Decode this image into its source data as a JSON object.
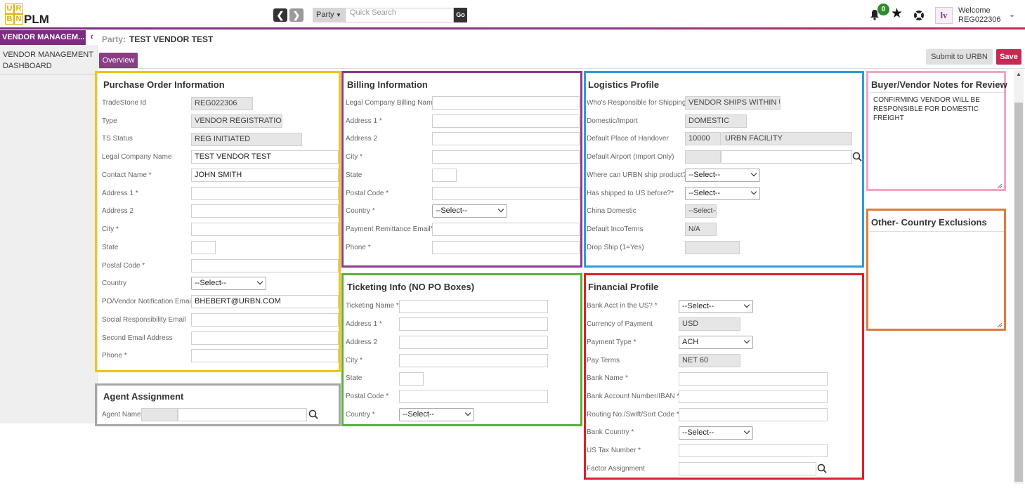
{
  "brand": {
    "logo_letters": [
      "U",
      "R",
      "B",
      "N"
    ],
    "app_name": "PLM"
  },
  "header": {
    "party_dropdown": "Party",
    "search_placeholder": "Quick Search",
    "go_label": "Go",
    "notification_count": "0",
    "welcome_label": "Welcome",
    "user_id": "REG022306",
    "avatar_initials": "lv"
  },
  "sidebar": {
    "header_label": "VENDOR MANAGEM...",
    "items": [
      {
        "label": "VENDOR MANAGEMENT DASHBOARD"
      }
    ]
  },
  "page": {
    "party_label": "Party:",
    "party_name": "TEST VENDOR TEST",
    "tab_overview": "Overview",
    "submit_label": "Submit to URBN",
    "save_label": "Save"
  },
  "po_info": {
    "title": "Purchase Order Information",
    "fields": [
      {
        "label": "TradeStone Id",
        "value": "REG022306"
      },
      {
        "label": "Type",
        "value": "VENDOR REGISTRATION"
      },
      {
        "label": "TS Status",
        "value": "REG INITIATED"
      },
      {
        "label": "Legal Company Name",
        "value": "TEST VENDOR TEST"
      },
      {
        "label": "Contact Name *",
        "value": "JOHN SMITH"
      },
      {
        "label": "Address 1 *",
        "value": ""
      },
      {
        "label": "Address 2",
        "value": ""
      },
      {
        "label": "City *",
        "value": ""
      },
      {
        "label": "State",
        "value": ""
      },
      {
        "label": "Postal Code *",
        "value": ""
      },
      {
        "label": "Country",
        "value": "--Select--"
      },
      {
        "label": "PO/Vendor Notification Email",
        "value": "BHEBERT@URBN.COM"
      },
      {
        "label": "Social Responsibility Email",
        "value": ""
      },
      {
        "label": "Second Email Address",
        "value": ""
      },
      {
        "label": "Phone *",
        "value": ""
      }
    ]
  },
  "agent": {
    "title": "Agent Assignment",
    "label": "Agent Name",
    "value": ""
  },
  "billing": {
    "title": "Billing Information",
    "fields": [
      {
        "label": "Legal Company Billing Name",
        "value": ""
      },
      {
        "label": "Address 1 *",
        "value": ""
      },
      {
        "label": "Address 2",
        "value": ""
      },
      {
        "label": "City *",
        "value": ""
      },
      {
        "label": "State",
        "value": ""
      },
      {
        "label": "Postal Code *",
        "value": ""
      },
      {
        "label": "Country *",
        "value": "--Select--"
      },
      {
        "label": "Payment Remittance Email*",
        "value": ""
      },
      {
        "label": "Phone *",
        "value": ""
      }
    ]
  },
  "ticketing": {
    "title": "Ticketing Info (NO PO Boxes)",
    "fields": [
      {
        "label": "Ticketing Name *",
        "value": ""
      },
      {
        "label": "Address 1 *",
        "value": ""
      },
      {
        "label": "Address 2",
        "value": ""
      },
      {
        "label": "City *",
        "value": ""
      },
      {
        "label": "State",
        "value": ""
      },
      {
        "label": "Postal Code *",
        "value": ""
      },
      {
        "label": "Country *",
        "value": "--Select--"
      }
    ]
  },
  "logistics": {
    "title": "Logistics Profile",
    "fields": [
      {
        "label": "Who's Responsible for Shipping",
        "value": "VENDOR SHIPS WITHIN USA"
      },
      {
        "label": "Domestic/Import",
        "value": "DOMESTIC"
      },
      {
        "label": "Default Place of Handover",
        "value": "10000",
        "value2": "URBN FACILITY"
      },
      {
        "label": "Default Airport (Import Only)",
        "value": "",
        "value2": ""
      },
      {
        "label": "Where can URBN ship product?*",
        "value": "--Select--"
      },
      {
        "label": "Has shipped to US before?*",
        "value": "--Select--"
      },
      {
        "label": "China Domestic",
        "value": "--Select--"
      },
      {
        "label": "Default IncoTerms",
        "value": "N/A"
      },
      {
        "label": "Drop Ship (1=Yes)",
        "value": ""
      }
    ]
  },
  "financial": {
    "title": "Financial Profile",
    "fields": [
      {
        "label": "Bank Acct in the US? *",
        "value": "--Select--"
      },
      {
        "label": "Currency of Payment",
        "value": "USD"
      },
      {
        "label": "Payment Type *",
        "value": "ACH"
      },
      {
        "label": "Pay Terms",
        "value": "NET 60"
      },
      {
        "label": "Bank Name *",
        "value": ""
      },
      {
        "label": "Bank Account Number/IBAN *",
        "value": ""
      },
      {
        "label": "Routing No./Swift/Sort Code *",
        "value": ""
      },
      {
        "label": "Bank Country *",
        "value": "--Select--"
      },
      {
        "label": "US Tax Number *",
        "value": ""
      },
      {
        "label": "Factor Assignment",
        "value": ""
      }
    ]
  },
  "notes": {
    "title": "Buyer/Vendor Notes for Review",
    "text": "CONFIRMING VENDOR WILL BE RESPONSIBLE FOR DOMESTIC FREIGHT"
  },
  "exclusions": {
    "title": "Other- Country Exclusions",
    "text": ""
  },
  "colors": {
    "brand_purple": "#7b2d80",
    "save_red": "#c42a52",
    "po_border": "#f0c419",
    "billing_border": "#8b3a8f",
    "logistics_border": "#2a9fd6",
    "notes_border": "#f4a3c8",
    "exclusions_border": "#e07b39",
    "agent_border": "#a6a6a6",
    "ticketing_border": "#5cad3c",
    "financial_border": "#e01f26"
  }
}
